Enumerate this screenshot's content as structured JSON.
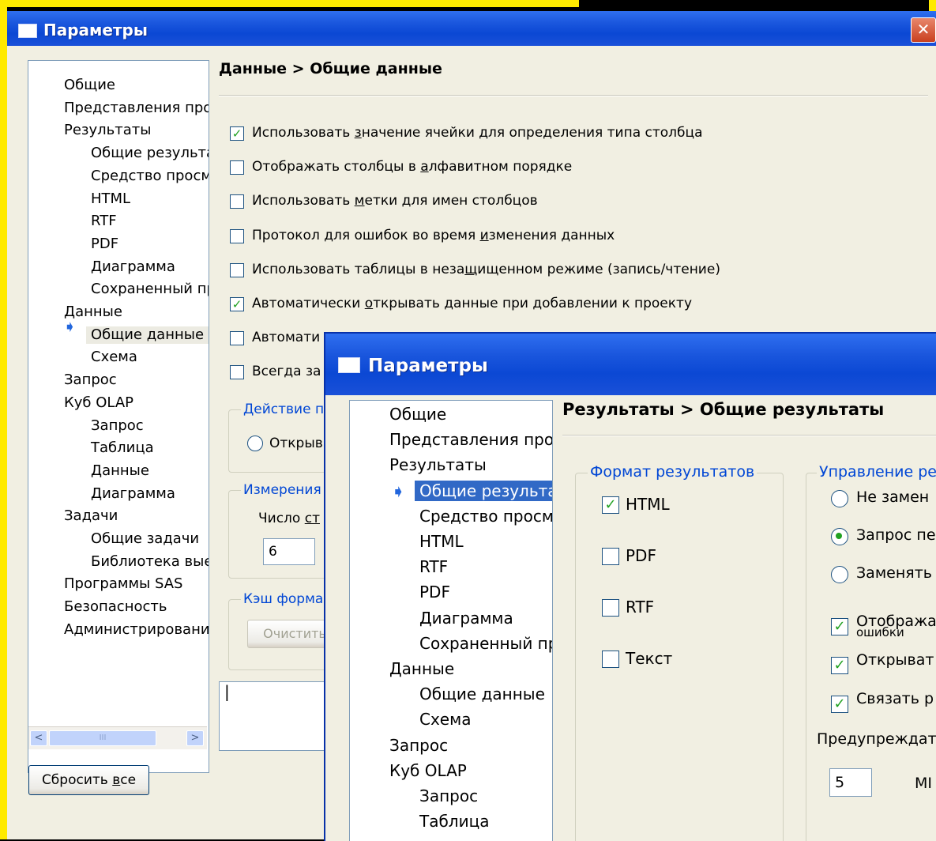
{
  "back": {
    "title": "Параметры",
    "tree": [
      {
        "label": "Общие",
        "level": 0
      },
      {
        "label": "Представления про",
        "level": 0
      },
      {
        "label": "Результаты",
        "level": 0
      },
      {
        "label": "Общие результа",
        "level": 1
      },
      {
        "label": "Средство просм",
        "level": 1
      },
      {
        "label": "HTML",
        "level": 1
      },
      {
        "label": "RTF",
        "level": 1
      },
      {
        "label": "PDF",
        "level": 1
      },
      {
        "label": "Диаграмма",
        "level": 1
      },
      {
        "label": "Сохраненный пр",
        "level": 1
      },
      {
        "label": "Данные",
        "level": 0
      },
      {
        "label": "Общие данные",
        "level": 1,
        "selected": true
      },
      {
        "label": "Схема",
        "level": 1
      },
      {
        "label": "Запрос",
        "level": 0
      },
      {
        "label": "Куб OLAP",
        "level": 0
      },
      {
        "label": "Запрос",
        "level": 1
      },
      {
        "label": "Таблица",
        "level": 1
      },
      {
        "label": "Данные",
        "level": 1
      },
      {
        "label": "Диаграмма",
        "level": 1
      },
      {
        "label": "Задачи",
        "level": 0
      },
      {
        "label": "Общие задачи",
        "level": 1
      },
      {
        "label": "Библиотека вые",
        "level": 1
      },
      {
        "label": "Программы SAS",
        "level": 0
      },
      {
        "label": "Безопасность",
        "level": 0
      },
      {
        "label": "Администрировани",
        "level": 0
      }
    ],
    "breadcrumb": "Данные > Общие данные",
    "checkboxes": [
      {
        "pre": "Использовать ",
        "u": "з",
        "post": "начение ячейки для определения типа столбца",
        "checked": true
      },
      {
        "pre": "Отображать столбцы в ",
        "u": "а",
        "post": "лфавитном порядке",
        "checked": false
      },
      {
        "pre": "Использовать ",
        "u": "м",
        "post": "етки для имен столбцов",
        "checked": false
      },
      {
        "pre": "Протокол для ошибок во время ",
        "u": "и",
        "post": "зменения данных",
        "checked": false
      },
      {
        "pre": "Использовать таблицы в неза",
        "u": "щ",
        "post": "ищенном режиме (запись/чтение)",
        "checked": false
      },
      {
        "pre": "Автоматически ",
        "u": "о",
        "post": "ткрывать данные при добавлении к проекту",
        "checked": true
      },
      {
        "pre": "Автомати",
        "u": "",
        "post": "",
        "checked": false
      },
      {
        "pre": "Всегда за",
        "u": "",
        "post": "",
        "checked": false
      }
    ],
    "group_action": "Действие п",
    "radio_open": "Открыв",
    "group_measure": "Измерения",
    "count_label_pre": "Число ",
    "count_label_u": "ст",
    "count_value": "6",
    "group_cache": "Кэш форма",
    "clear_button": "Очистить",
    "reset_pre": "Сбросить ",
    "reset_u": "в",
    "reset_post": "се",
    "scroll_left": "<",
    "scroll_right": ">",
    "scroll_grip": "III",
    "status_text": "|",
    "close": "✕"
  },
  "front": {
    "title": "Параметры",
    "tree": [
      {
        "label": "Общие",
        "level": 0
      },
      {
        "label": "Представления про",
        "level": 0
      },
      {
        "label": "Результаты",
        "level": 0
      },
      {
        "label": "Общие результа",
        "level": 1,
        "selected": true
      },
      {
        "label": "Средство просм",
        "level": 1
      },
      {
        "label": "HTML",
        "level": 1
      },
      {
        "label": "RTF",
        "level": 1
      },
      {
        "label": "PDF",
        "level": 1
      },
      {
        "label": "Диаграмма",
        "level": 1
      },
      {
        "label": "Сохраненный пр",
        "level": 1
      },
      {
        "label": "Данные",
        "level": 0
      },
      {
        "label": "Общие данные",
        "level": 1
      },
      {
        "label": "Схема",
        "level": 1
      },
      {
        "label": "Запрос",
        "level": 0
      },
      {
        "label": "Куб OLAP",
        "level": 0
      },
      {
        "label": "Запрос",
        "level": 1
      },
      {
        "label": "Таблица",
        "level": 1
      }
    ],
    "breadcrumb": "Результаты > Общие результаты",
    "format_group": "Формат результатов",
    "formats": [
      {
        "label": "HTML",
        "checked": true
      },
      {
        "label": "PDF",
        "checked": false
      },
      {
        "label": "RTF",
        "checked": false
      },
      {
        "label": "Текст",
        "checked": false
      }
    ],
    "manage_group": "Управление ре",
    "radios": [
      {
        "label": "Не замен",
        "on": false
      },
      {
        "label": "Запрос пе",
        "on": true
      },
      {
        "label": "Заменять",
        "on": false
      }
    ],
    "checks": [
      {
        "label": "Отобража",
        "label2": "ошибки",
        "checked": true
      },
      {
        "label": "Открыват",
        "checked": true
      },
      {
        "label": "Связать р",
        "checked": true
      }
    ],
    "warn_label": "Предупреждат",
    "size_value": "5",
    "size_unit": "МІ"
  },
  "colors": {
    "highlight": "#ffea00",
    "check": "#21a121",
    "legend": "#0046d5"
  }
}
